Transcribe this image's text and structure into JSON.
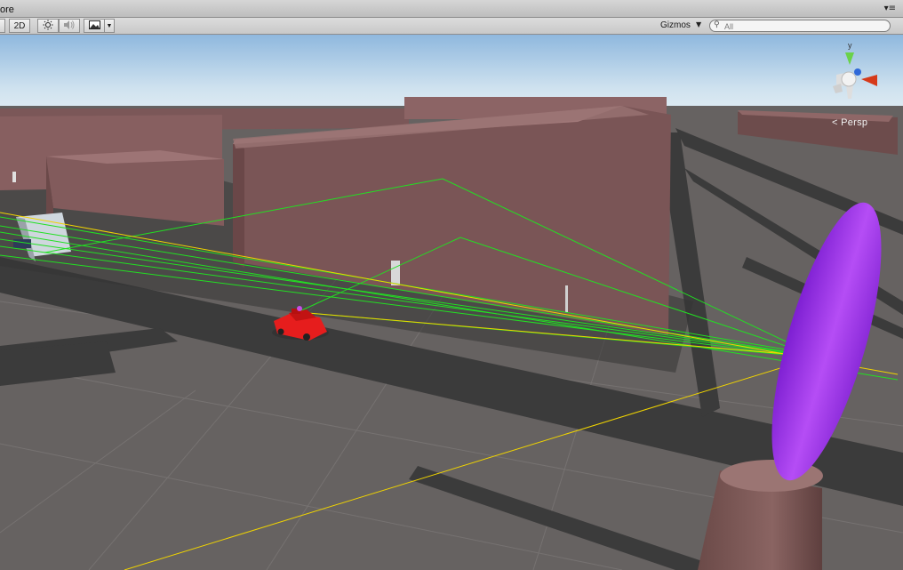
{
  "window": {
    "title": "ore",
    "menu_glyph": "▾≡"
  },
  "toolbar": {
    "mode_2d_label": "2D",
    "lighting_icon": "sun-icon",
    "audio_icon": "speaker-icon",
    "effects_icon": "image-icon",
    "gizmos_label": "Gizmos",
    "search_placeholder": "All"
  },
  "scene": {
    "projection_label": "< Persp",
    "axis_labels": {
      "y": "y"
    }
  }
}
